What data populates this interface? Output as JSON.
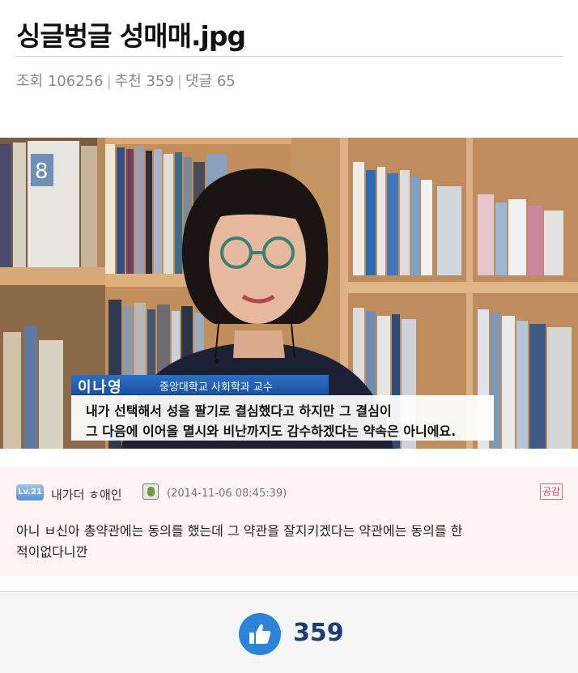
{
  "post": {
    "title": "싱글벙글 성매매.jpg",
    "views_label": "조회",
    "views": "106256",
    "recommend_label": "추천",
    "recommend": "359",
    "comments_label": "댓글",
    "comments": "65"
  },
  "news": {
    "book_label": "8",
    "name": "이나영",
    "affiliation": "중앙대학교 사회학과 교수",
    "caption_line1": "내가 선택해서 성을 팔기로 결심했다고 하지만 그 결심이",
    "caption_line2": "그 다음에 이어올 멸시와 비난까지도 감수하겠다는 약속은 아니에요."
  },
  "comment": {
    "level_badge": "Lv.21",
    "nickname": "내가더 ㅎ애인",
    "date": "(2014-11-06 08:45:39)",
    "agree_label": "공감",
    "line1": "아니 ㅂ신아 총약관에는 동의를 했는데 그 약관을 잘지키겠다는 약관에는 동의를 한",
    "line2": "적이없다니깐"
  },
  "like": {
    "icon": "thumbs-up-icon",
    "count": "359",
    "color": "#2b84d9"
  }
}
